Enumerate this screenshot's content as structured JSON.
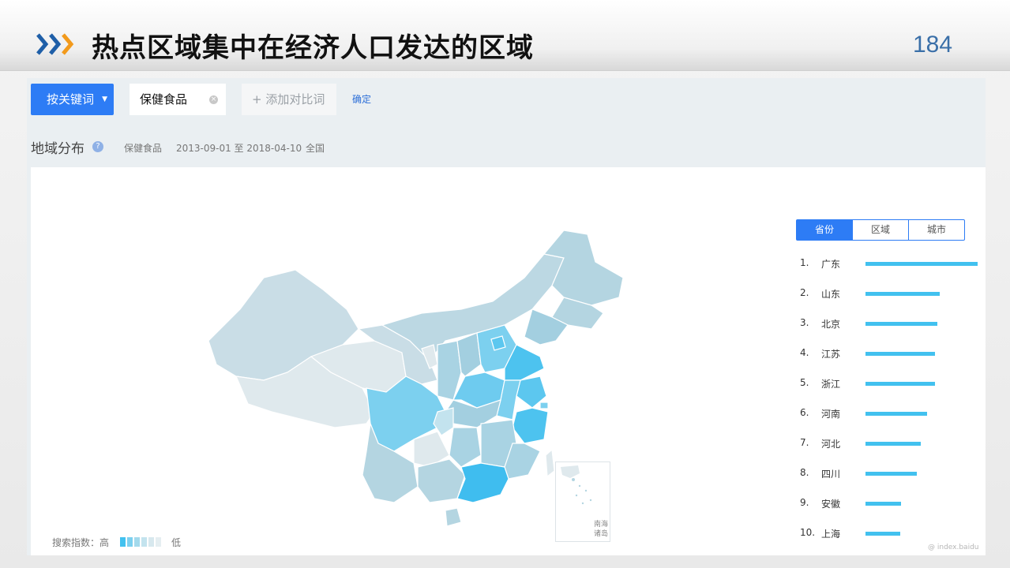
{
  "slide": {
    "title": "热点区域集中在经济人口发达的区域",
    "page_number": "184"
  },
  "toolbar": {
    "keyword_button": "按关键词",
    "keyword_chip": "保健食品",
    "add_compare": "+ 添加对比词",
    "confirm": "确定"
  },
  "section": {
    "title": "地域分布",
    "keyword": "保健食品",
    "date_range": "2013-09-01 至 2018-04-10",
    "scope": "全国"
  },
  "map": {
    "nanhai_label_1": "南海",
    "nanhai_label_2": "诸岛",
    "legend_prefix": "搜索指数：高",
    "legend_suffix": "低",
    "legend_colors": [
      "#42c1ef",
      "#7cd0ef",
      "#a3d9ec",
      "#c3e3ee",
      "#d7e8ee",
      "#e5eef1"
    ]
  },
  "tabs": [
    {
      "label": "省份",
      "active": true
    },
    {
      "label": "区域",
      "active": false
    },
    {
      "label": "城市",
      "active": false
    }
  ],
  "chart_data": {
    "type": "bar",
    "categories": [
      "广东",
      "山东",
      "北京",
      "江苏",
      "浙江",
      "河南",
      "河北",
      "四川",
      "安徽",
      "上海"
    ],
    "ranks": [
      "1.",
      "2.",
      "3.",
      "4.",
      "5.",
      "6.",
      "7.",
      "8.",
      "9.",
      "10."
    ],
    "values": [
      100,
      66,
      64,
      62,
      62,
      55,
      49,
      46,
      32,
      31
    ],
    "bar_color": "#42c1ef"
  },
  "watermark": "@ index.baidu"
}
